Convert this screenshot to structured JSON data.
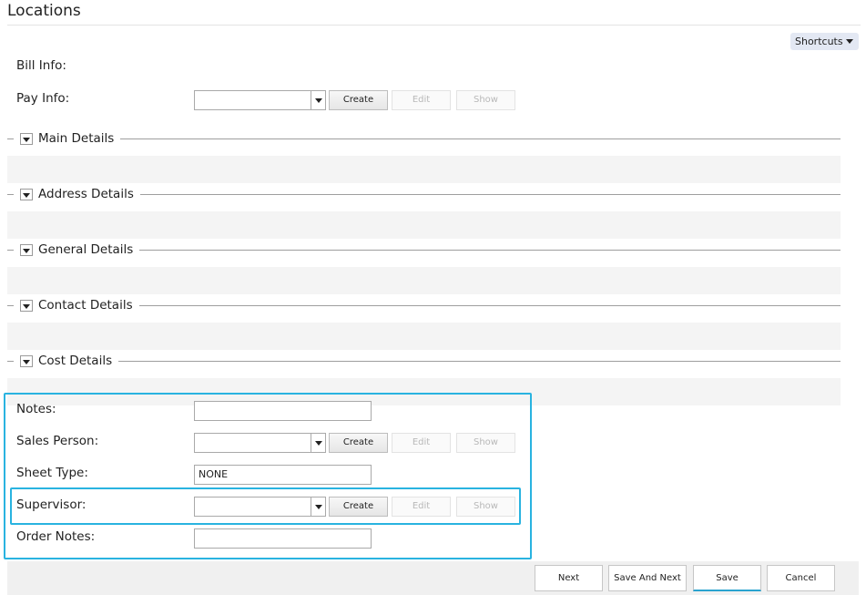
{
  "page": {
    "title": "Locations"
  },
  "shortcuts": {
    "label": "Shortcuts"
  },
  "bill_info": {
    "label": "Bill Info:"
  },
  "pay_info": {
    "label": "Pay Info:",
    "value": "",
    "create": "Create",
    "edit": "Edit",
    "show": "Show"
  },
  "sections": [
    {
      "label": "Main Details"
    },
    {
      "label": "Address Details"
    },
    {
      "label": "General Details"
    },
    {
      "label": "Contact Details"
    },
    {
      "label": "Cost Details"
    }
  ],
  "notes": {
    "label": "Notes:",
    "value": ""
  },
  "sales_person": {
    "label": "Sales Person:",
    "value": "",
    "create": "Create",
    "edit": "Edit",
    "show": "Show"
  },
  "sheet_type": {
    "label": "Sheet Type:",
    "value": "NONE"
  },
  "supervisor": {
    "label": "Supervisor:",
    "value": "",
    "create": "Create",
    "edit": "Edit",
    "show": "Show"
  },
  "order_notes": {
    "label": "Order Notes:",
    "value": ""
  },
  "footer": {
    "next": "Next",
    "save_and_next": "Save And Next",
    "save": "Save",
    "cancel": "Cancel"
  },
  "colors": {
    "highlight": "#29b3e0",
    "shortcuts_bg": "#e3e8f3",
    "save_accent": "#2aa3cf"
  }
}
